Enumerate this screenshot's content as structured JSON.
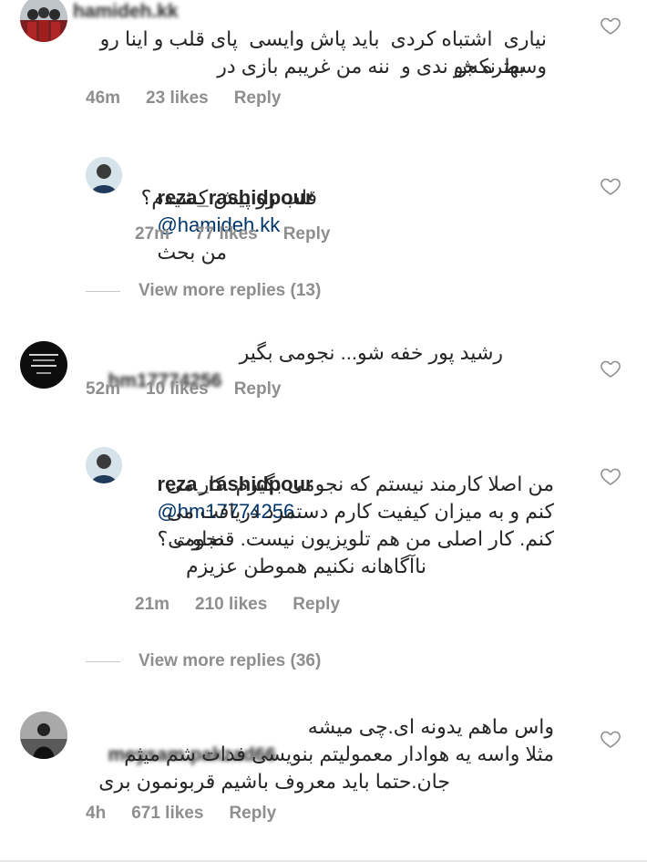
{
  "comments": [
    {
      "username": "hamideh.kk",
      "text_line1": "بهتره جو ندی و  ننه من غریبم بازی در",
      "text_line2": "نیاری  اشتباه کردی  باید پاش وایسی  پای قلب و اینا رو",
      "text_line3": "وسط نکش",
      "time": "46m",
      "likes": "23 likes",
      "reply": "Reply"
    },
    {
      "username": "reza_rashidpour",
      "mention": "@hamideh.kk",
      "text_line1": "من بحث",
      "text_line2": "قلب رو پیش کشیدم؟",
      "time": "27m",
      "likes": "77 likes",
      "reply": "Reply"
    },
    {
      "username": "hm17774256",
      "text_line1": "رشید پور خفه شو... نجومی بگیر",
      "time": "52m",
      "likes": "10 likes",
      "reply": "Reply"
    },
    {
      "username": "reza_rashidpour",
      "mention": "@hm17774256",
      "text_line1": "نجومی؟",
      "text_line2": "من اصلا کارمند نیستم که نجومی بگیرم. کار می",
      "text_line3": "کنم و به میزان کیفیت کارم دستمزد دریافت می",
      "text_line4": "کنم. کار اصلی من هم تلویزیون نیست. قضاوت",
      "text_line5": "ناآگاهانه نکنیم هموطن عزیزم",
      "time": "21m",
      "likes": "210 likes",
      "reply": "Reply"
    },
    {
      "username": "meysam.pakzad66",
      "text_line1": "واس ماهم یدونه ای.چی میشه",
      "text_line2": "مثلا واسه یه هوادار معمولیتم بنویسی فدات شم میثم",
      "text_line3": "جان.حتما باید معروف باشیم قربونمون بری",
      "time": "4h",
      "likes": "671 likes",
      "reply": "Reply"
    }
  ],
  "view_more": [
    {
      "label": "View more replies (13)"
    },
    {
      "label": "View more replies (36)"
    }
  ],
  "icons": {
    "heart": "heart-outline-icon"
  },
  "colors": {
    "text": "#262626",
    "meta": "#8e8e8e",
    "mention": "#003569"
  }
}
